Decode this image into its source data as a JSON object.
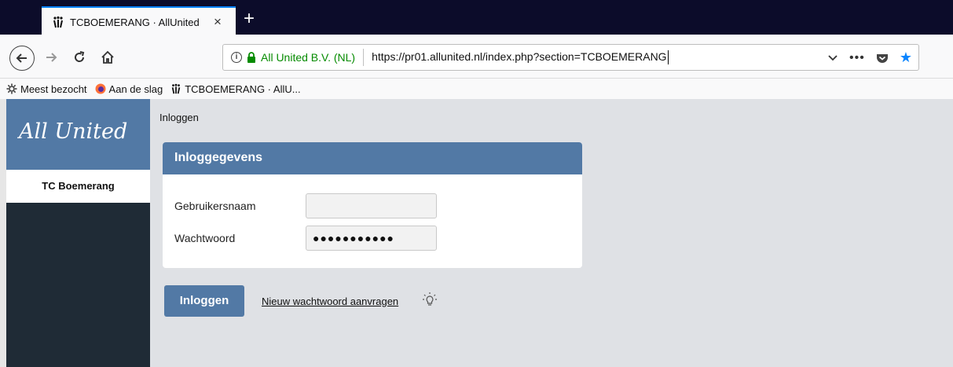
{
  "browser": {
    "tab": {
      "title": "TCBOEMERANG · AllUnited",
      "close_glyph": "×"
    },
    "new_tab_glyph": "+",
    "urlbar": {
      "identity": "All United B.V. (NL)",
      "url": "https://pr01.allunited.nl/index.php?section=TCBOEMERANG"
    },
    "bookmarks": [
      {
        "label": "Meest bezocht",
        "icon": "gear-icon"
      },
      {
        "label": "Aan de slag",
        "icon": "firefox-icon"
      },
      {
        "label": "TCBOEMERANG · AllU...",
        "icon": "allunited-favicon"
      }
    ],
    "colors": {
      "accent": "#0a84ff",
      "secure": "#058b00"
    }
  },
  "sidebar": {
    "logo": "All United",
    "organization": "TC Boemerang"
  },
  "page": {
    "breadcrumb": "Inloggen",
    "panel_title": "Inloggegevens",
    "username_label": "Gebruikersnaam",
    "username_value": "",
    "password_label": "Wachtwoord",
    "password_value": "●●●●●●●●●●●",
    "login_button": "Inloggen",
    "reset_link": "Nieuw wachtwoord aanvragen"
  },
  "colors": {
    "brand": "#5279a5",
    "sidebar": "#1f2b36",
    "background": "#dfe1e5"
  }
}
